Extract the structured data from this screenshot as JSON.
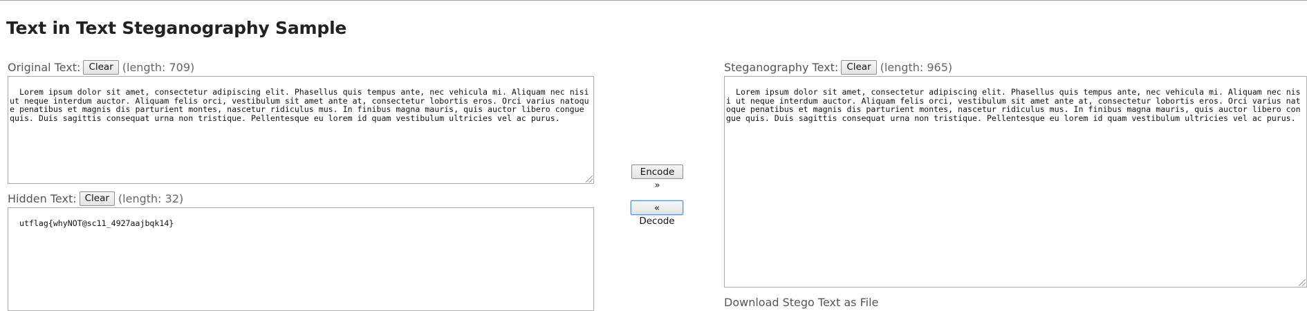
{
  "page": {
    "title": "Text in Text Steganography Sample"
  },
  "original": {
    "label": "Original Text:",
    "clear_label": "Clear",
    "length_text": "(length: 709)",
    "value": "Lorem ipsum dolor sit amet, consectetur adipiscing elit. Phasellus quis tempus ante, nec vehicula mi. Aliquam nec nisi ut neque interdum auctor. Aliquam felis orci, vestibulum sit amet ante at, consectetur lobortis eros. Orci varius natoque penatibus et magnis dis parturient montes, nascetur ridiculus mus. In finibus magna mauris, quis auctor libero congue quis. Duis sagittis consequat urna non tristique. Pellentesque eu lorem id quam vestibulum ultricies vel ac purus."
  },
  "hidden": {
    "label": "Hidden Text:",
    "clear_label": "Clear",
    "length_text": "(length: 32)",
    "value": "utflag{whyNOT@sc11_4927aajbqk14}"
  },
  "actions": {
    "encode_label": "Encode »",
    "decode_label": "« Decode"
  },
  "stego": {
    "label": "Steganography Text:",
    "clear_label": "Clear",
    "length_text": "(length: 965)",
    "value": "Lorem ipsum dolor sit amet, consectetur adipiscing elit. Phasellus quis tempus ante, nec vehicula mi. Aliquam nec nisi ut neque interdum auctor. Aliquam felis orci, vestibulum sit amet ante at, consectetur lobortis eros. Orci varius natoque penatibus et magnis dis parturient montes, nascetur ridiculus mus. In finibus magna mauris, quis auctor libero congue quis. Duis sagittis consequat urna non tristique. Pellentesque eu lorem id quam vestibulum ultricies vel ac purus.",
    "download_label": "Download Stego Text as File"
  }
}
